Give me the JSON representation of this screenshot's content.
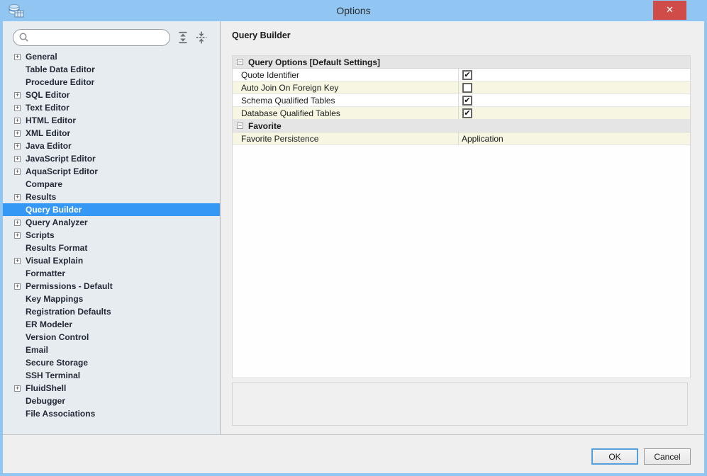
{
  "window": {
    "title": "Options",
    "close_label": "✕"
  },
  "icons": {
    "app": "database-grid-icon",
    "close": "close-icon",
    "search": "magnifier-icon",
    "expand_all": "expand-all-icon",
    "collapse_all": "collapse-all-icon",
    "tree_expand": "+",
    "group_collapse": "−",
    "checkbox_check": "✔"
  },
  "colors": {
    "titlebar_blue": "#92c6f2",
    "close_red": "#cf4c49",
    "selection_blue": "#3598f4",
    "row_stripe_yellow": "#f6f6e3",
    "group_header_gray": "#e5e5e5",
    "sidebar_bg": "#e7ecf1"
  },
  "sidebar": {
    "search": {
      "value": "",
      "placeholder": ""
    },
    "items": [
      {
        "label": "General",
        "expandable": true,
        "selected": false
      },
      {
        "label": "Table Data Editor",
        "expandable": false,
        "selected": false
      },
      {
        "label": "Procedure Editor",
        "expandable": false,
        "selected": false
      },
      {
        "label": "SQL Editor",
        "expandable": true,
        "selected": false
      },
      {
        "label": "Text Editor",
        "expandable": true,
        "selected": false
      },
      {
        "label": "HTML Editor",
        "expandable": true,
        "selected": false
      },
      {
        "label": "XML Editor",
        "expandable": true,
        "selected": false
      },
      {
        "label": "Java Editor",
        "expandable": true,
        "selected": false
      },
      {
        "label": "JavaScript Editor",
        "expandable": true,
        "selected": false
      },
      {
        "label": "AquaScript Editor",
        "expandable": true,
        "selected": false
      },
      {
        "label": "Compare",
        "expandable": false,
        "selected": false
      },
      {
        "label": "Results",
        "expandable": true,
        "selected": false
      },
      {
        "label": "Query Builder",
        "expandable": false,
        "selected": true
      },
      {
        "label": "Query Analyzer",
        "expandable": true,
        "selected": false
      },
      {
        "label": "Scripts",
        "expandable": true,
        "selected": false
      },
      {
        "label": "Results Format",
        "expandable": false,
        "selected": false
      },
      {
        "label": "Visual Explain",
        "expandable": true,
        "selected": false
      },
      {
        "label": "Formatter",
        "expandable": false,
        "selected": false
      },
      {
        "label": "Permissions - Default",
        "expandable": true,
        "selected": false
      },
      {
        "label": "Key Mappings",
        "expandable": false,
        "selected": false
      },
      {
        "label": "Registration Defaults",
        "expandable": false,
        "selected": false
      },
      {
        "label": "ER Modeler",
        "expandable": false,
        "selected": false
      },
      {
        "label": "Version Control",
        "expandable": false,
        "selected": false
      },
      {
        "label": "Email",
        "expandable": false,
        "selected": false
      },
      {
        "label": "Secure Storage",
        "expandable": false,
        "selected": false
      },
      {
        "label": "SSH Terminal",
        "expandable": false,
        "selected": false
      },
      {
        "label": "FluidShell",
        "expandable": true,
        "selected": false
      },
      {
        "label": "Debugger",
        "expandable": false,
        "selected": false
      },
      {
        "label": "File Associations",
        "expandable": false,
        "selected": false
      }
    ]
  },
  "main": {
    "title": "Query Builder",
    "table": {
      "rows": [
        {
          "type": "group",
          "label": "Query Options [Default Settings]"
        },
        {
          "type": "prop",
          "label": "Quote Identifier",
          "value_type": "checkbox",
          "checked": true
        },
        {
          "type": "prop",
          "label": "Auto Join On Foreign Key",
          "value_type": "checkbox",
          "checked": false
        },
        {
          "type": "prop",
          "label": "Schema Qualified Tables",
          "value_type": "checkbox",
          "checked": true
        },
        {
          "type": "prop",
          "label": "Database Qualified Tables",
          "value_type": "checkbox",
          "checked": true
        },
        {
          "type": "group",
          "label": "Favorite"
        },
        {
          "type": "prop",
          "label": "Favorite Persistence",
          "value_type": "text",
          "value": "Application"
        }
      ]
    }
  },
  "footer": {
    "ok_label": "OK",
    "cancel_label": "Cancel"
  }
}
